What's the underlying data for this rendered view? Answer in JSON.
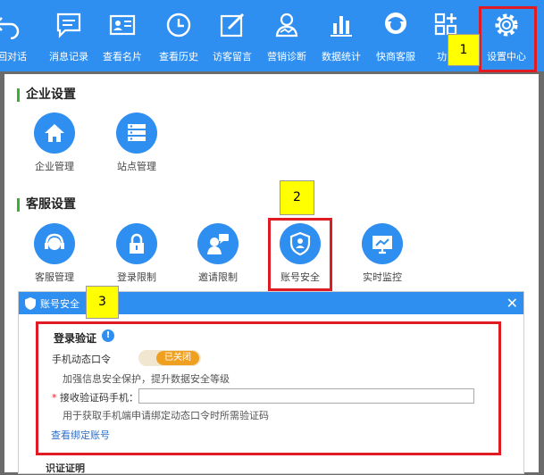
{
  "toolbar": {
    "items": [
      {
        "label": "返回对话",
        "icon": "return-arrow-icon"
      },
      {
        "label": "消息记录",
        "icon": "message-icon"
      },
      {
        "label": "查看名片",
        "icon": "contact-card-icon"
      },
      {
        "label": "查看历史",
        "icon": "clock-icon"
      },
      {
        "label": "访客留言",
        "icon": "edit-icon"
      },
      {
        "label": "营销诊断",
        "icon": "diagnosis-icon"
      },
      {
        "label": "数据统计",
        "icon": "bar-chart-icon"
      },
      {
        "label": "快商客服",
        "icon": "customer-service-icon"
      },
      {
        "label": "功能",
        "icon": "apps-icon"
      },
      {
        "label": "设置中心",
        "icon": "settings-gear-icon"
      }
    ]
  },
  "enterprise": {
    "title": "企业设置",
    "items": [
      {
        "label": "企业管理",
        "icon": "home-icon"
      },
      {
        "label": "站点管理",
        "icon": "server-icon"
      }
    ]
  },
  "service": {
    "title": "客服设置",
    "items": [
      {
        "label": "客服管理",
        "icon": "headset-icon"
      },
      {
        "label": "登录限制",
        "icon": "lock-icon"
      },
      {
        "label": "邀请限制",
        "icon": "invite-chat-icon"
      },
      {
        "label": "账号安全",
        "icon": "shield-user-icon"
      },
      {
        "label": "实时监控",
        "icon": "monitor-icon"
      }
    ]
  },
  "dialog": {
    "title": "账号安全",
    "close": "✕",
    "section_title": "登录验证",
    "info_icon": "!",
    "otp_label": "手机动态口令",
    "toggle_state": "已关闭",
    "otp_hint": "加强信息安全保护，提升数据安全等级",
    "required_mark": "*",
    "phone_label": "接收验证码手机：",
    "phone_value": "",
    "phone_hint": "用于获取手机端申请绑定动态口令时所需验证码",
    "link": "查看绑定账号",
    "next_section_partial": "识证证明"
  },
  "annotations": {
    "note1": "1",
    "note2": "2",
    "note3": "3"
  },
  "colors": {
    "primary": "#2f8ff0",
    "accent_green": "#3cb034",
    "highlight_red": "#e01b24",
    "toggle_orange": "#f0a020"
  }
}
